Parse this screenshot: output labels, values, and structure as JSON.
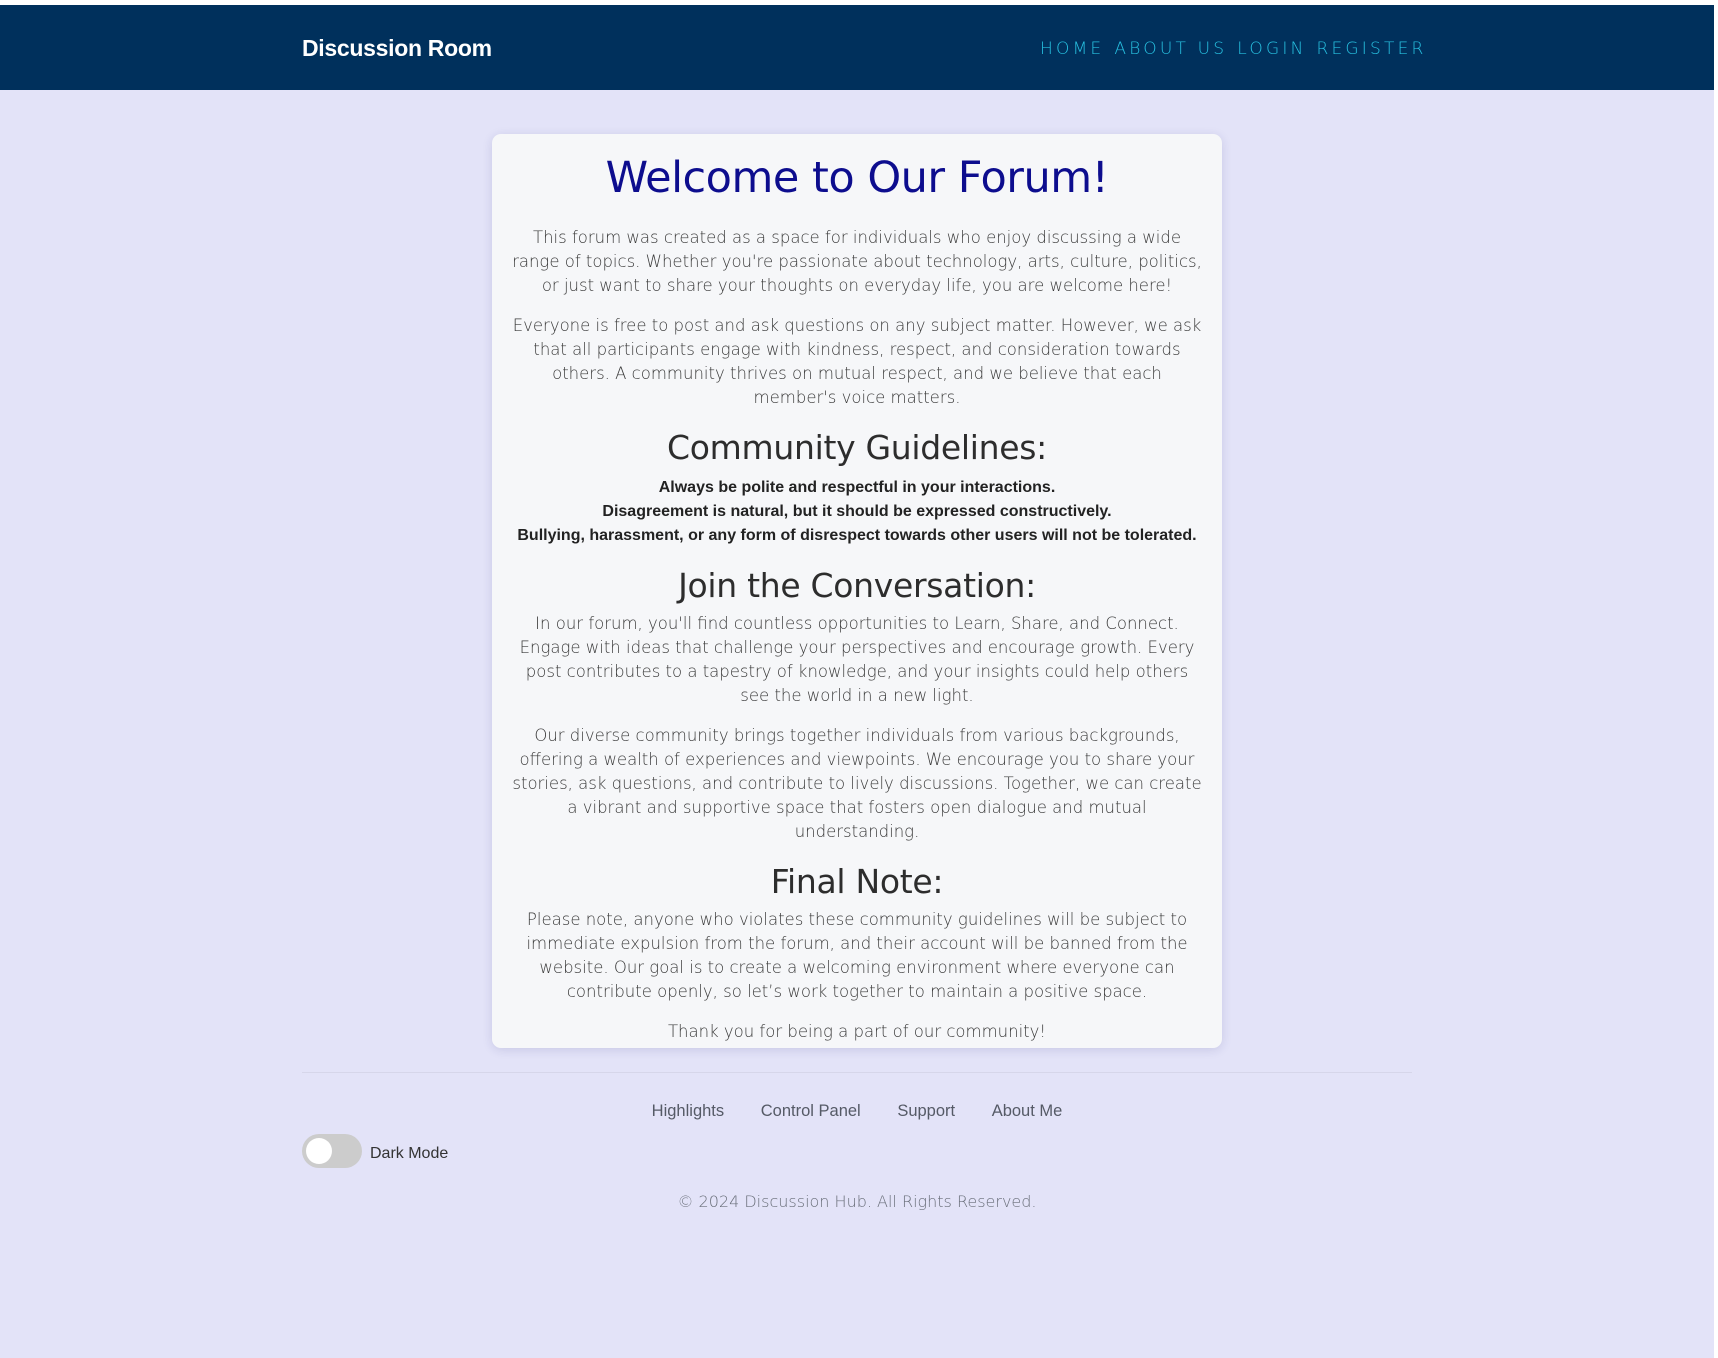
{
  "header": {
    "brand": "Discussion Room",
    "nav": [
      "HOME",
      "ABOUT US",
      "LOGIN",
      "REGISTER"
    ]
  },
  "main": {
    "title": "Welcome to Our Forum!",
    "intro": [
      "This forum was created as a space for individuals who enjoy discussing a wide range of topics. Whether you're passionate about technology, arts, culture, politics, or just want to share your thoughts on everyday life, you are welcome here!",
      "Everyone is free to post and ask questions on any subject matter. However, we ask that all participants engage with kindness, respect, and consideration towards others. A community thrives on mutual respect, and we believe that each member's voice matters."
    ],
    "guidelines_title": "Community Guidelines:",
    "guidelines": [
      "Always be polite and respectful in your interactions.",
      "Disagreement is natural, but it should be expressed constructively.",
      "Bullying, harassment, or any form of disrespect towards other users will not be tolerated."
    ],
    "join_title": "Join the Conversation:",
    "join": [
      "In our forum, you'll find countless opportunities to Learn, Share, and Connect. Engage with ideas that challenge your perspectives and encourage growth. Every post contributes to a tapestry of knowledge, and your insights could help others see the world in a new light.",
      "Our diverse community brings together individuals from various backgrounds, offering a wealth of experiences and viewpoints. We encourage you to share your stories, ask questions, and contribute to lively discussions. Together, we can create a vibrant and supportive space that fosters open dialogue and mutual understanding."
    ],
    "final_title": "Final Note:",
    "final": [
      "Please note, anyone who violates these community guidelines will be subject to immediate expulsion from the forum, and their account will be banned from the website. Our goal is to create a welcoming environment where everyone can contribute openly, so let’s work together to maintain a positive space.",
      "Thank you for being a part of our community!"
    ]
  },
  "footer": {
    "links": [
      "Highlights",
      "Control Panel",
      "Support",
      "About Me"
    ],
    "dark_mode_label": "Dark Mode",
    "copyright": "© 2024 Discussion Hub. All Rights Reserved."
  },
  "colors": {
    "header_bg": "#00305c",
    "nav_link": "#27c0e0",
    "title": "#0d0d8e",
    "page_bg": "#e3e3f8"
  }
}
